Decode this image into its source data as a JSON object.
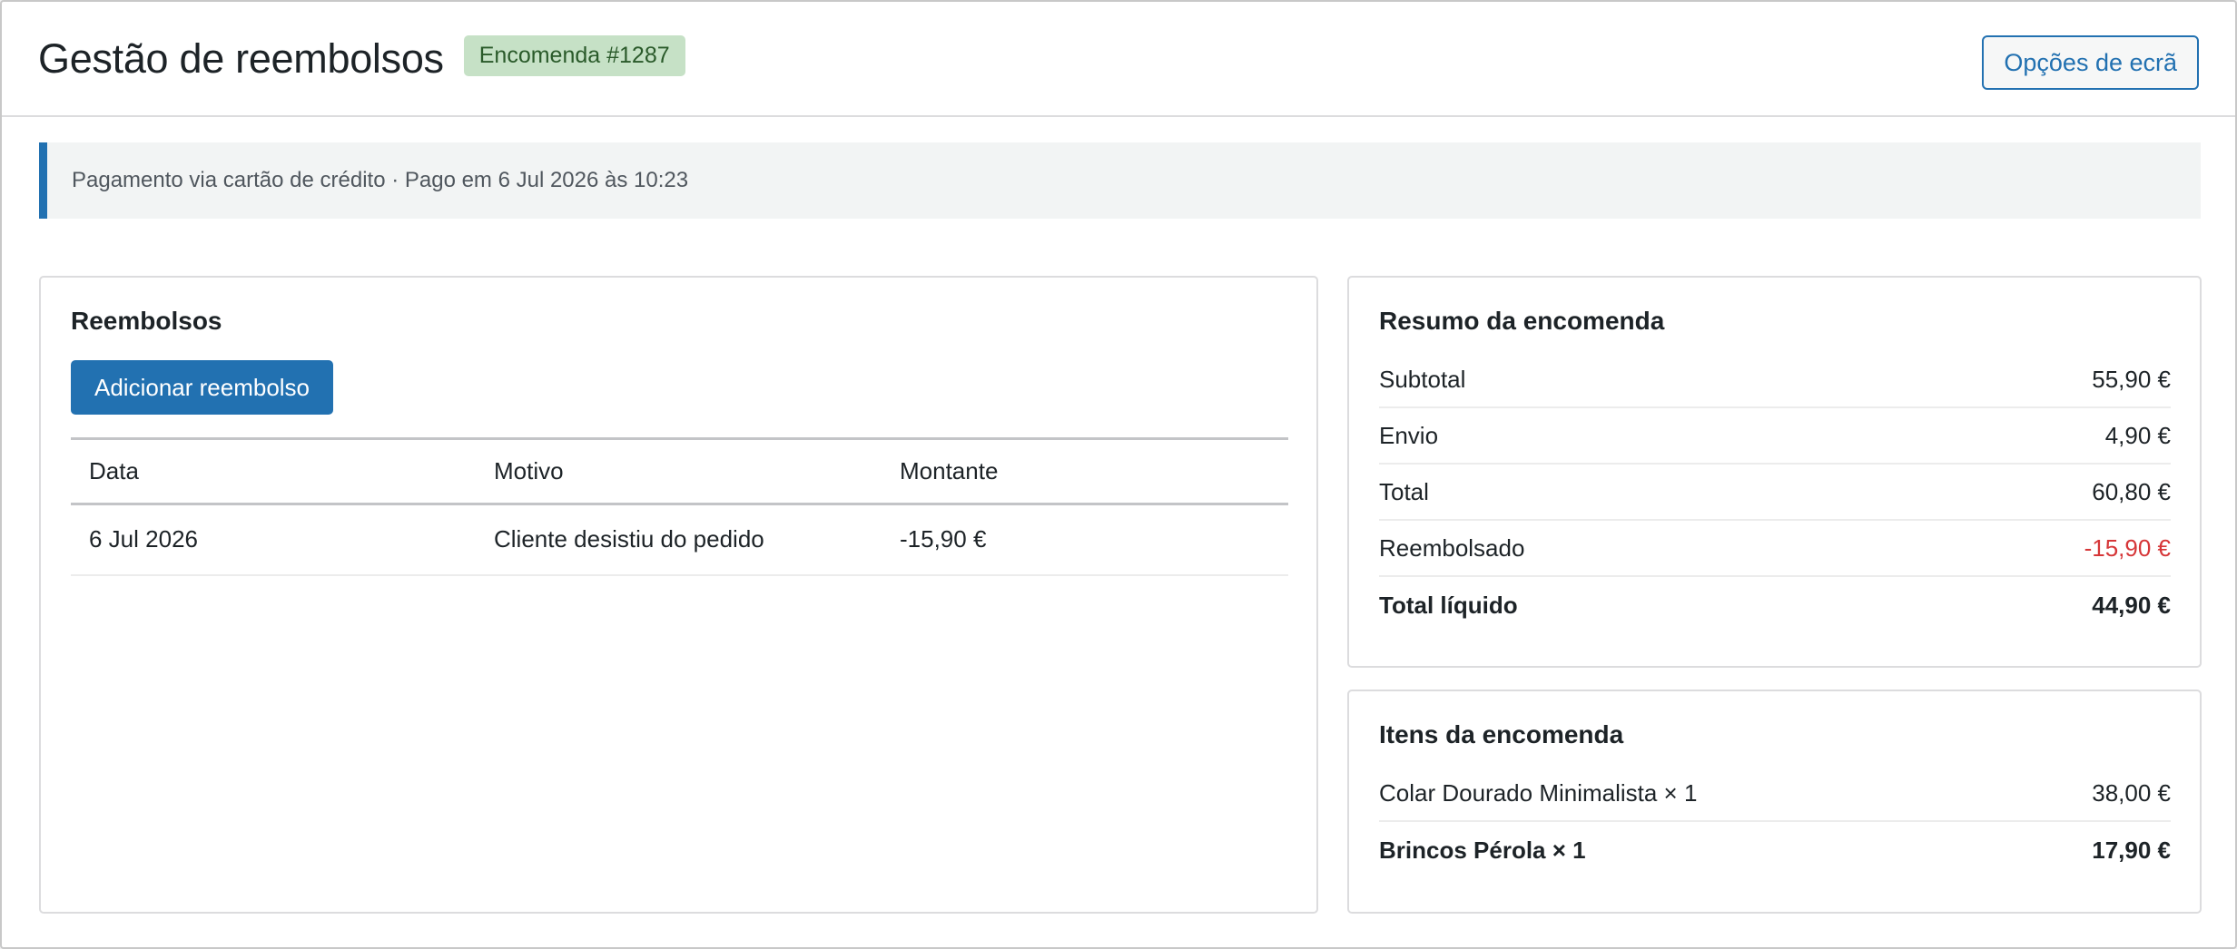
{
  "header": {
    "title": "Gestão de reembolsos",
    "order_badge": "Encomenda #1287",
    "screen_options_label": "Opções de ecrã"
  },
  "notice": {
    "text": "Pagamento via cartão de crédito · Pago em 6 Jul 2026 às 10:23"
  },
  "refunds": {
    "title": "Reembolsos",
    "add_button_label": "Adicionar reembolso",
    "columns": [
      "Data",
      "Motivo",
      "Montante"
    ],
    "rows": [
      {
        "date": "6 Jul 2026",
        "reason": "Cliente desistiu do pedido",
        "amount": "-15,90 €"
      }
    ]
  },
  "summary": {
    "title": "Resumo da encomenda",
    "rows": [
      {
        "label": "Subtotal",
        "value": "55,90 €"
      },
      {
        "label": "Envio",
        "value": "4,90 €"
      },
      {
        "label": "Total",
        "value": "60,80 €"
      },
      {
        "label": "Reembolsado",
        "value": "-15,90 €"
      },
      {
        "label": "Total líquido",
        "value": "44,90 €"
      }
    ]
  },
  "items": {
    "title": "Itens da encomenda",
    "rows": [
      {
        "label": "Colar Dourado Minimalista × 1",
        "value": "38,00 €"
      },
      {
        "label": "Brincos Pérola × 1",
        "value": "17,90 €"
      }
    ]
  },
  "colors": {
    "accent": "#2271b1",
    "negative": "#d63638",
    "badge_bg": "#c6e1c6",
    "badge_text": "#2a5a2a"
  }
}
